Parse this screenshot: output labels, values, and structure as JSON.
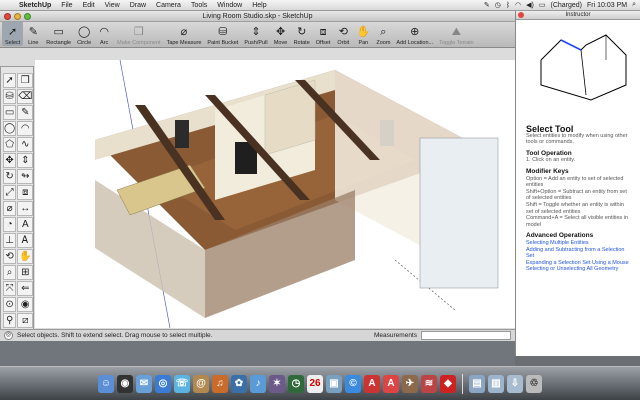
{
  "menubar": {
    "apple_icon": "apple-icon",
    "items": [
      "SketchUp",
      "File",
      "Edit",
      "View",
      "Draw",
      "Camera",
      "Tools",
      "Window",
      "Help"
    ],
    "battery": "(Charged)",
    "clock": "Fri 10:03 PM"
  },
  "window": {
    "title": "Living Room Studio.skp - SketchUp"
  },
  "toolbar": {
    "tools": [
      {
        "label": "Select",
        "icon": "arrow-icon",
        "active": true
      },
      {
        "label": "Line",
        "icon": "pencil-icon"
      },
      {
        "label": "Rectangle",
        "icon": "rectangle-icon"
      },
      {
        "label": "Circle",
        "icon": "circle-icon"
      },
      {
        "label": "Arc",
        "icon": "arc-icon"
      },
      {
        "label": "Make Component",
        "icon": "component-icon",
        "disabled": true
      },
      {
        "label": "Tape Measure",
        "icon": "tape-icon"
      },
      {
        "label": "Paint Bucket",
        "icon": "bucket-icon"
      },
      {
        "label": "Push/Pull",
        "icon": "pushpull-icon"
      },
      {
        "label": "Move",
        "icon": "move-icon"
      },
      {
        "label": "Rotate",
        "icon": "rotate-icon"
      },
      {
        "label": "Offset",
        "icon": "offset-icon"
      },
      {
        "label": "Orbit",
        "icon": "orbit-icon"
      },
      {
        "label": "Pan",
        "icon": "pan-icon"
      },
      {
        "label": "Zoom",
        "icon": "zoom-icon"
      },
      {
        "label": "Add Location...",
        "icon": "location-icon"
      },
      {
        "label": "Toggle Terrain",
        "icon": "terrain-icon",
        "disabled": true
      }
    ]
  },
  "status": {
    "text": "Select objects. Shift to extend select. Drag mouse to select multiple.",
    "measurements_label": "Measurements"
  },
  "instructor": {
    "panel_title": "Instructor",
    "heading": "Select Tool",
    "intro": "Select entities to modify when using other tools or commands.",
    "op_heading": "Tool Operation",
    "op_text": "1. Click on an entity.",
    "mod_heading": "Modifier Keys",
    "mod_lines": [
      "Option = Add an entity to set of selected entities",
      "Shift+Option = Subtract an entity from set of selected entities",
      "Shift = Toggle whether an entity is within set of selected entities",
      "Command+A = Select all visible entities in model"
    ],
    "adv_heading": "Advanced Operations",
    "adv_links": [
      "Selecting Multiple Entities",
      "Adding and Subtracting from a Selection Set",
      "Expanding a Selection Set Using a Mouse",
      "Selecting or Unselecting All Geometry"
    ]
  },
  "colors": {
    "floor": "#8a5a34",
    "beam": "#4a3222",
    "wall": "#f2ecdc",
    "sofa": "#d8c68c",
    "link": "#2255dd"
  },
  "dock": {
    "icons": [
      "finder-icon",
      "dashboard-icon",
      "mail-icon",
      "safari-icon",
      "ichat-icon",
      "address-book-icon",
      "garageband-icon",
      "iphoto-icon",
      "itunes-icon",
      "imovie-icon",
      "time-machine-icon",
      "ical-icon",
      "preview-icon",
      "itunes-store-icon",
      "pdf-icon",
      "pdf2-icon",
      "mail-stamp-icon",
      "dreamweaver-icon",
      "sketchup-icon",
      "folder-icon",
      "documents-icon",
      "downloads-icon",
      "trash-icon"
    ]
  }
}
